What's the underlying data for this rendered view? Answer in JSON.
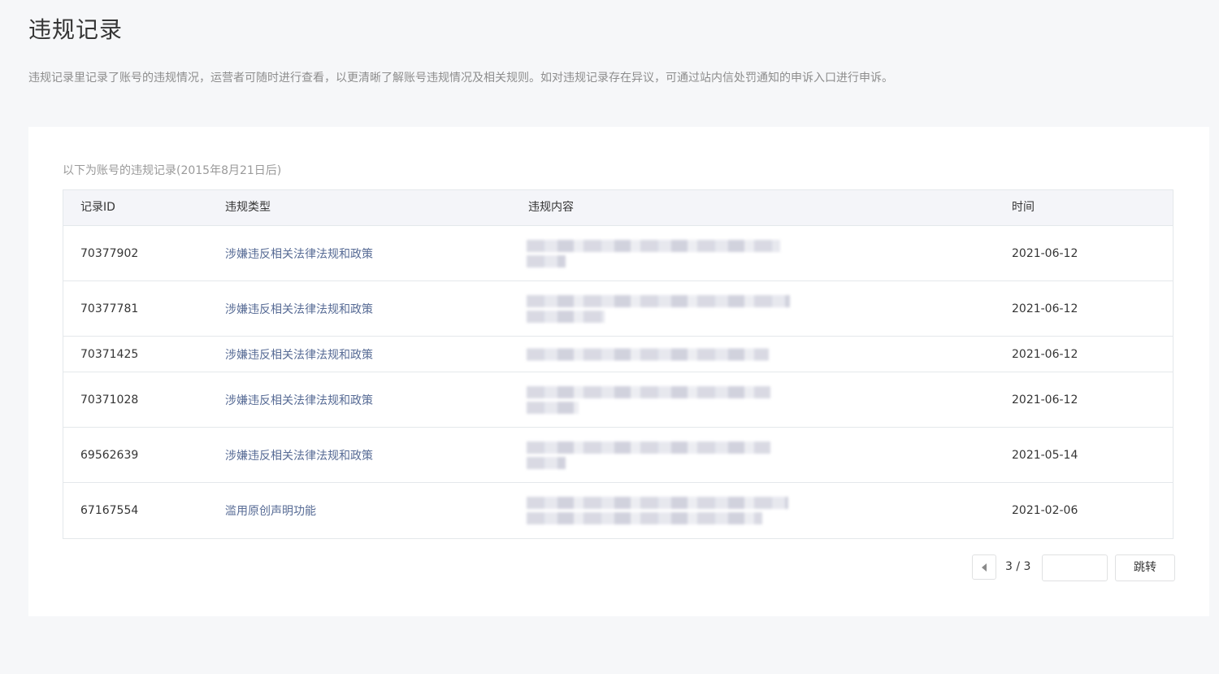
{
  "page": {
    "title": "违规记录",
    "description": "违规记录里记录了账号的违规情况，运营者可随时进行查看，以更清晰了解账号违规情况及相关规则。如对违规记录存在异议，可通过站内信处罚通知的申诉入口进行申诉。"
  },
  "records": {
    "subtitle": "以下为账号的违规记录(2015年8月21日后)",
    "columns": {
      "id": "记录ID",
      "type": "违规类型",
      "content": "违规内容",
      "time": "时间"
    },
    "rows": [
      {
        "id": "70377902",
        "type": "涉嫌违反相关法律法规和政策",
        "time": "2021-06-12"
      },
      {
        "id": "70377781",
        "type": "涉嫌违反相关法律法规和政策",
        "time": "2021-06-12"
      },
      {
        "id": "70371425",
        "type": "涉嫌违反相关法律法规和政策",
        "time": "2021-06-12"
      },
      {
        "id": "70371028",
        "type": "涉嫌违反相关法律法规和政策",
        "time": "2021-06-12"
      },
      {
        "id": "69562639",
        "type": "涉嫌违反相关法律法规和政策",
        "time": "2021-05-14"
      },
      {
        "id": "67167554",
        "type": "滥用原创声明功能",
        "time": "2021-02-06"
      }
    ]
  },
  "pager": {
    "page_text": "3 / 3",
    "input_value": "",
    "jump_label": "跳转"
  },
  "colors": {
    "link": "#576b95",
    "background": "#f6f7f9",
    "header_bg": "#f4f5f9",
    "border": "#e4e8eb"
  }
}
